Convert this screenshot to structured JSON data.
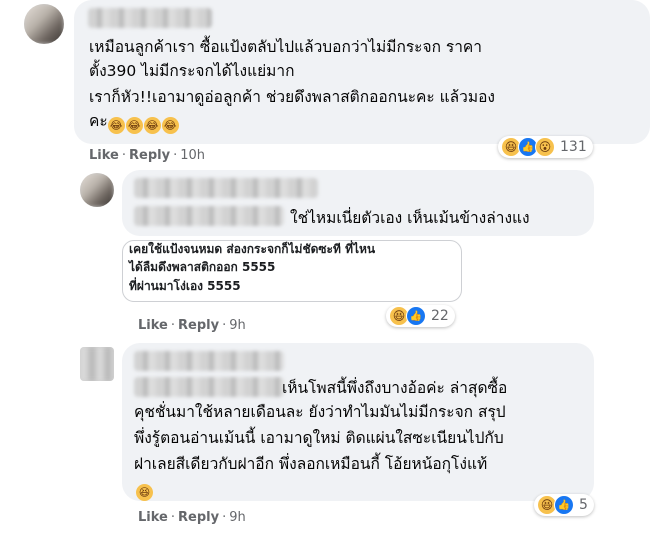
{
  "comments": [
    {
      "text_lines": [
        "เหมือนลูกค้าเรา ซื้อแป้งตลับไปแล้วบอกว่าไม่มีกระจก ราคา",
        "ตั้ง390 ไม่มีกระจกได้ไงแย่มาก",
        "เราก็หัว!!เอามาดูอ่อลูกค้า ช่วยดึงพลาสติกออกนะคะ แล้วมอง",
        "คะ"
      ],
      "like_label": "Like",
      "reply_label": "Reply",
      "time": "10h",
      "reaction_icons": [
        "haha-icon",
        "like-icon",
        "wow-icon"
      ],
      "reaction_count": "131"
    },
    {
      "text_lines": [
        "ใช่ไหมเนี่ยตัวเอง เห็นเม้นข้างล่างแง"
      ],
      "quote_lines": [
        "เคยใช้แป้งจนหมด ส่องกระจกก็ไม่ชัดซะที ที่ไหน",
        "ได้ลืมดึงพลาสติกออก 5555",
        "ที่ผ่านมาโง่เอง 5555"
      ],
      "like_label": "Like",
      "reply_label": "Reply",
      "time": "9h",
      "reaction_icons": [
        "haha-icon",
        "like-icon"
      ],
      "reaction_count": "22"
    },
    {
      "text_lines": [
        "เห็นโพสนี้พึ่งถึงบางอ้อค่ะ ล่าสุดซื้อ",
        "คุชชั่นมาใช้หลายเดือนละ ยังว่าทำไมมันไม่มีกระจก สรุป",
        "พึ่งรู้ตอนอ่านเม้นนี้ เอามาดูใหม่ ติดแผ่นใสซะเนียนไปกับ",
        "ฝาเลยสีเดียวกับฝาอีก พึ่งลอกเหมือนกี้ โอ้ยหน้อกุโง่แท้"
      ],
      "like_label": "Like",
      "reply_label": "Reply",
      "time": "9h",
      "reaction_icons": [
        "haha-icon",
        "like-icon"
      ],
      "reaction_count": "5"
    }
  ],
  "colors": {
    "bubble": "#f0f2f5",
    "meta_text": "#65676b",
    "like_blue": "#1877f2",
    "haha_yellow": "#f7c14d"
  }
}
